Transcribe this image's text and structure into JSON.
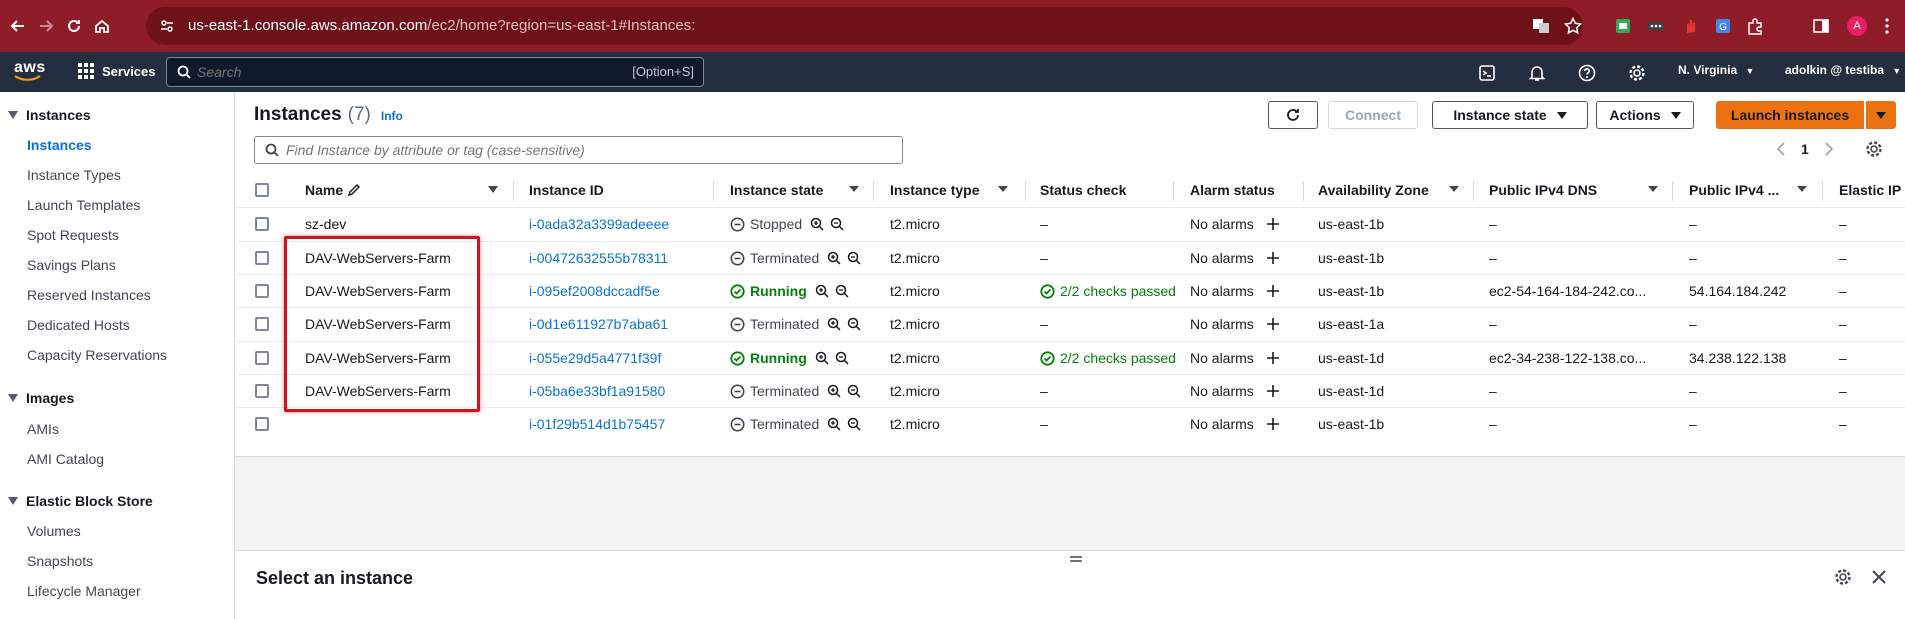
{
  "browser": {
    "url_host": "us-east-1.console.aws.amazon.com",
    "url_path": "/ec2/home?region=us-east-1#Instances:",
    "profile_initial": "A"
  },
  "aws_nav": {
    "logo": "aws",
    "services_label": "Services",
    "search_placeholder": "Search",
    "search_shortcut": "[Option+S]",
    "region": "N. Virginia",
    "account": "adolkin @ testiba"
  },
  "sidebar": {
    "sections": [
      {
        "title": "Instances",
        "items": [
          "Instances",
          "Instance Types",
          "Launch Templates",
          "Spot Requests",
          "Savings Plans",
          "Reserved Instances",
          "Dedicated Hosts",
          "Capacity Reservations"
        ]
      },
      {
        "title": "Images",
        "items": [
          "AMIs",
          "AMI Catalog"
        ]
      },
      {
        "title": "Elastic Block Store",
        "items": [
          "Volumes",
          "Snapshots",
          "Lifecycle Manager"
        ]
      }
    ],
    "active_item": "Instances"
  },
  "main": {
    "title": "Instances",
    "count": "(7)",
    "info": "Info",
    "buttons": {
      "connect": "Connect",
      "instance_state": "Instance state",
      "actions": "Actions",
      "launch": "Launch instances"
    },
    "filter_placeholder": "Find Instance by attribute or tag (case-sensitive)",
    "page_number": "1"
  },
  "table": {
    "columns": [
      "Name",
      "Instance ID",
      "Instance state",
      "Instance type",
      "Status check",
      "Alarm status",
      "Availability Zone",
      "Public IPv4 DNS",
      "Public IPv4 ...",
      "Elastic IP"
    ],
    "rows": [
      {
        "name": "sz-dev",
        "id": "i-0ada32a3399adeeee",
        "state": "Stopped",
        "type": "t2.micro",
        "status": "–",
        "alarm": "No alarms",
        "az": "us-east-1b",
        "dns": "–",
        "ipv4": "–",
        "eip": "–"
      },
      {
        "name": "DAV-WebServers-Farm",
        "id": "i-00472632555b78311",
        "state": "Terminated",
        "type": "t2.micro",
        "status": "–",
        "alarm": "No alarms",
        "az": "us-east-1b",
        "dns": "–",
        "ipv4": "–",
        "eip": "–"
      },
      {
        "name": "DAV-WebServers-Farm",
        "id": "i-095ef2008dccadf5e",
        "state": "Running",
        "type": "t2.micro",
        "status": "2/2 checks passed",
        "alarm": "No alarms",
        "az": "us-east-1b",
        "dns": "ec2-54-164-184-242.co...",
        "ipv4": "54.164.184.242",
        "eip": "–"
      },
      {
        "name": "DAV-WebServers-Farm",
        "id": "i-0d1e611927b7aba61",
        "state": "Terminated",
        "type": "t2.micro",
        "status": "–",
        "alarm": "No alarms",
        "az": "us-east-1a",
        "dns": "–",
        "ipv4": "–",
        "eip": "–"
      },
      {
        "name": "DAV-WebServers-Farm",
        "id": "i-055e29d5a4771f39f",
        "state": "Running",
        "type": "t2.micro",
        "status": "2/2 checks passed",
        "alarm": "No alarms",
        "az": "us-east-1d",
        "dns": "ec2-34-238-122-138.co...",
        "ipv4": "34.238.122.138",
        "eip": "–"
      },
      {
        "name": "DAV-WebServers-Farm",
        "id": "i-05ba6e33bf1a91580",
        "state": "Terminated",
        "type": "t2.micro",
        "status": "–",
        "alarm": "No alarms",
        "az": "us-east-1d",
        "dns": "–",
        "ipv4": "–",
        "eip": "–"
      },
      {
        "name": "",
        "id": "i-01f29b514d1b75457",
        "state": "Terminated",
        "type": "t2.micro",
        "status": "–",
        "alarm": "No alarms",
        "az": "us-east-1b",
        "dns": "–",
        "ipv4": "–",
        "eip": "–"
      }
    ]
  },
  "split_panel": {
    "title": "Select an instance"
  },
  "colors": {
    "browser_bar": "#8e1d27",
    "aws_nav": "#232f3e",
    "link": "#0972d3",
    "running": "#037f0c",
    "launch_button": "#ec7211",
    "highlight": "#d0121b"
  }
}
